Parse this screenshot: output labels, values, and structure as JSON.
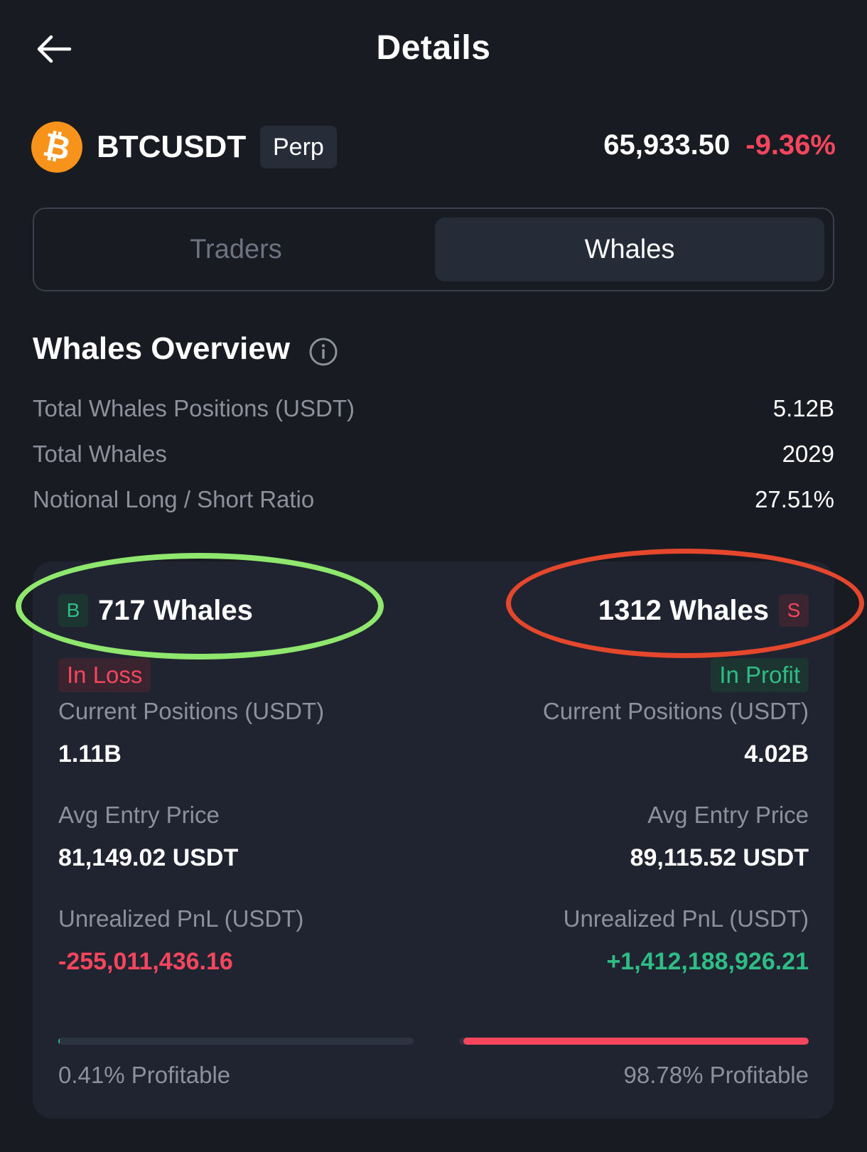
{
  "header": {
    "title": "Details",
    "back_icon": "arrow-left-icon"
  },
  "instrument": {
    "coin_icon": "bitcoin-icon",
    "coin_color": "#f7931a",
    "symbol": "BTCUSDT",
    "type_badge": "Perp",
    "price": "65,933.50",
    "change": "-9.36%"
  },
  "tabs": [
    {
      "label": "Traders",
      "selected": false
    },
    {
      "label": "Whales",
      "selected": true
    }
  ],
  "overview": {
    "title": "Whales Overview",
    "info_icon": "info-circle-icon",
    "stats": [
      {
        "label": "Total Whales Positions (USDT)",
        "value": "5.12B"
      },
      {
        "label": "Total Whales",
        "value": "2029"
      },
      {
        "label": "Notional Long / Short Ratio",
        "value": "27.51%"
      }
    ]
  },
  "long_side": {
    "badge": "B",
    "whales": "717 Whales",
    "status": "In Loss",
    "positions_label": "Current Positions (USDT)",
    "positions_value": "1.11B",
    "entry_label": "Avg Entry Price",
    "entry_value": "81,149.02 USDT",
    "pnl_label": "Unrealized PnL (USDT)",
    "pnl_value": "-255,011,436.16",
    "profitable_pct": 0.41,
    "profitable_text": "0.41% Profitable"
  },
  "short_side": {
    "badge": "S",
    "whales": "1312 Whales",
    "status": "In Profit",
    "positions_label": "Current Positions (USDT)",
    "positions_value": "4.02B",
    "entry_label": "Avg Entry Price",
    "entry_value": "89,115.52 USDT",
    "pnl_label": "Unrealized PnL (USDT)",
    "pnl_value": "+1,412,188,926.21",
    "profitable_pct": 98.78,
    "profitable_text": "98.78% Profitable"
  },
  "colors": {
    "background": "#181b22",
    "card": "#1f2430",
    "positive": "#2ebd85",
    "negative": "#f6465d",
    "annotation_green": "#8fe86d",
    "annotation_red": "#e5472d"
  }
}
